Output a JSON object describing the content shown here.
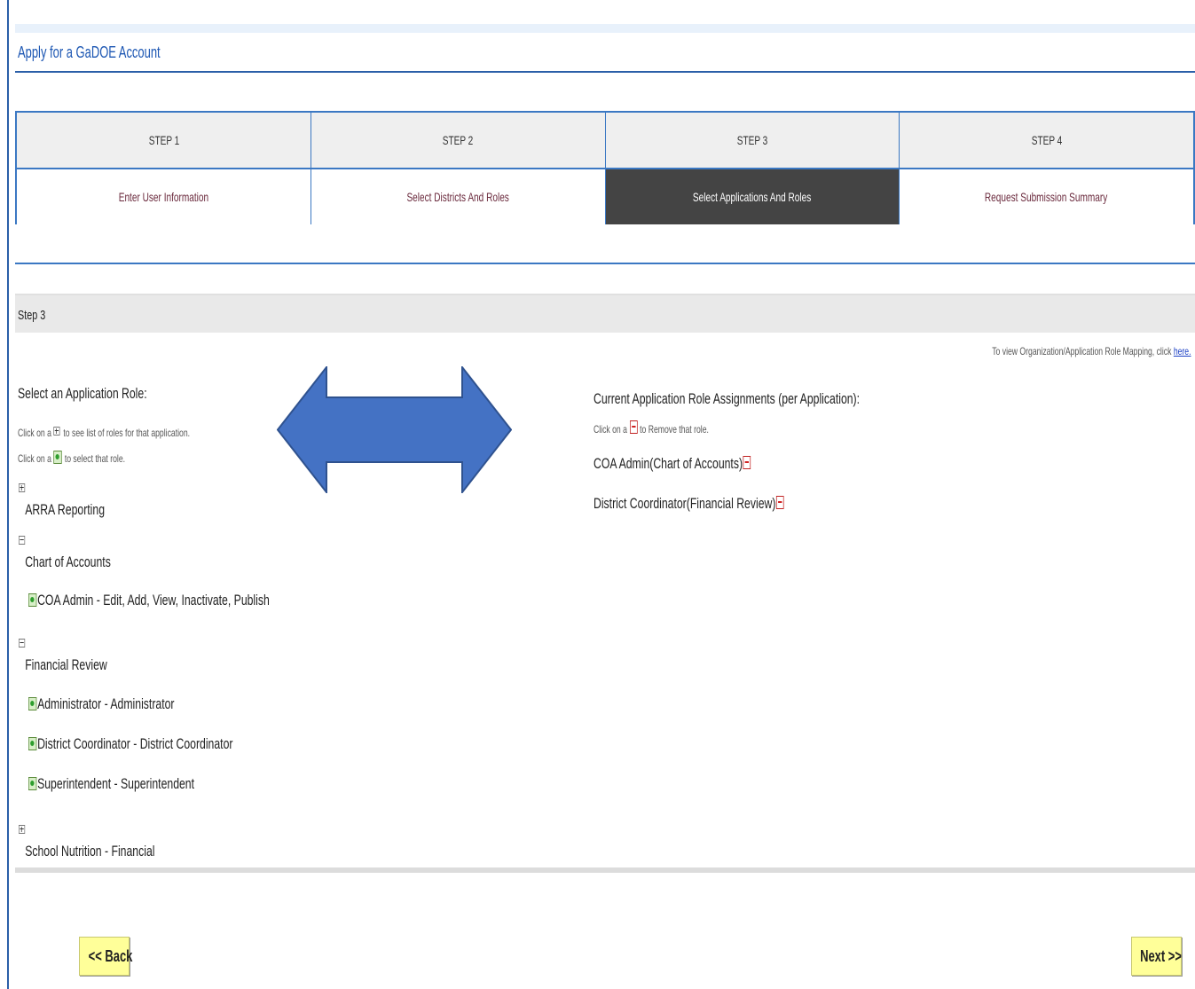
{
  "page": {
    "title": "Apply for a GaDOE Account"
  },
  "steps": [
    {
      "number": "STEP 1",
      "label": "Enter User Information",
      "active": false
    },
    {
      "number": "STEP 2",
      "label": "Select Districts And Roles",
      "active": false
    },
    {
      "number": "STEP 3",
      "label": "Select Applications And Roles",
      "active": true
    },
    {
      "number": "STEP 4",
      "label": "Request Submission Summary",
      "active": false
    }
  ],
  "section": {
    "heading": "Step 3",
    "mapping_note": "To view Organization/Application Role Mapping, click",
    "mapping_link": "here."
  },
  "left_panel": {
    "heading": "Select an Application Role:",
    "hint_expand_pre": "Click on a",
    "hint_expand_post": "to see list of roles for that application.",
    "hint_select_pre": "Click on a",
    "hint_select_post": "to select that role.",
    "applications": [
      {
        "name": "ARRA Reporting",
        "expanded": false
      },
      {
        "name": "Chart of Accounts",
        "expanded": true,
        "roles": [
          "COA Admin - Edit, Add, View, Inactivate, Publish"
        ]
      },
      {
        "name": "Financial Review",
        "expanded": true,
        "roles": [
          "Administrator - Administrator",
          "District Coordinator - District Coordinator",
          "Superintendent - Superintendent"
        ]
      },
      {
        "name": "School Nutrition - Financial",
        "expanded": false
      }
    ]
  },
  "right_panel": {
    "heading": "Current Application Role Assignments (per Application):",
    "hint_remove_pre": "Click on a",
    "hint_remove_post": "to Remove that role.",
    "assignments": [
      "COA Admin(Chart of Accounts)",
      "District Coordinator(Financial Review)"
    ]
  },
  "buttons": {
    "back": "<< Back",
    "next": "Next >>"
  },
  "colors": {
    "accent_blue": "#2b5fa8",
    "arrow_fill": "#4472c4",
    "active_step": "#444444",
    "button_fill": "#ffff99"
  }
}
